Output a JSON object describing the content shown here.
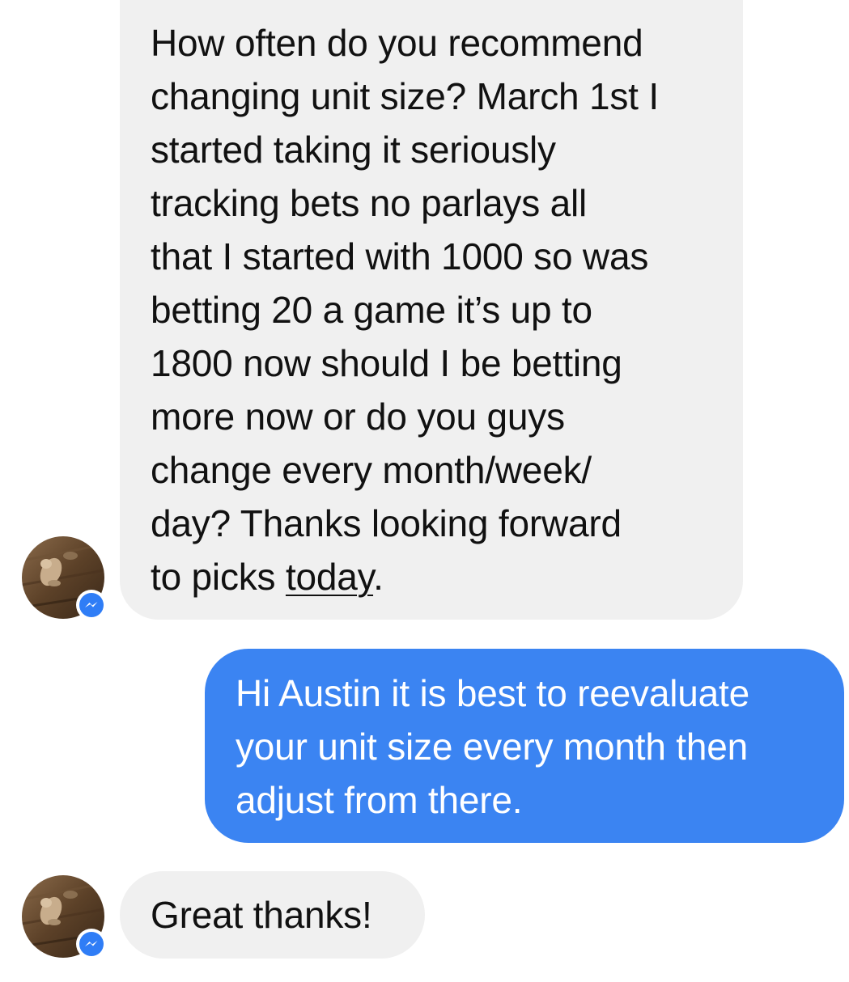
{
  "conversation": {
    "messages": [
      {
        "sender": "contact",
        "lines": [
          "How often do you recommend",
          "changing unit size? March 1st I",
          "started taking it seriously",
          "tracking bets no parlays all",
          "that I started with 1000 so was",
          "betting 20 a game it’s up to",
          "1800 now should I be betting",
          "more now or do you guys",
          "change every month/week/",
          "day? Thanks looking forward"
        ],
        "last_line_prefix": "to picks ",
        "last_line_link": "today",
        "last_line_suffix": "."
      },
      {
        "sender": "me",
        "lines": [
          "Hi Austin it is best to reevaluate",
          "your unit size every month then",
          "adjust from there."
        ]
      },
      {
        "sender": "contact",
        "lines": [
          "Great thanks!"
        ]
      }
    ]
  },
  "icons": {
    "avatar": "contact-avatar-photo",
    "badge": "messenger-icon"
  },
  "colors": {
    "incoming_bubble": "#f0f0f0",
    "outgoing_bubble": "#3b84f2",
    "messenger_badge": "#2f7df6",
    "incoming_text": "#111111",
    "outgoing_text": "#ffffff"
  }
}
